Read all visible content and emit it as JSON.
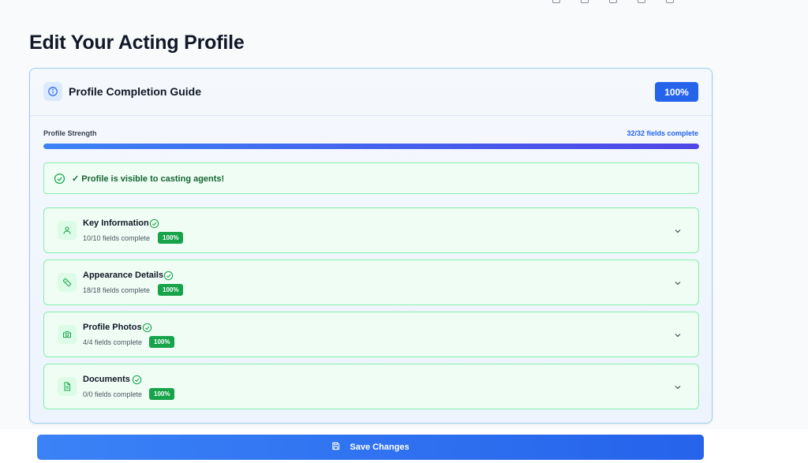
{
  "page": {
    "title": "Edit Your Acting Profile"
  },
  "guide": {
    "title": "Profile Completion Guide",
    "completion_badge": "100%",
    "strength_label": "Profile Strength",
    "strength_count": "32/32 fields complete",
    "strength_fraction": 1.0,
    "visible_message": "✓ Profile is visible to casting agents!"
  },
  "sections": [
    {
      "title": "Key Information",
      "count": "10/10 fields complete",
      "badge": "100%",
      "icon": "user-icon"
    },
    {
      "title": "Appearance Details",
      "count": "18/18 fields complete",
      "badge": "100%",
      "icon": "ruler-icon"
    },
    {
      "title": "Profile Photos",
      "count": "4/4 fields complete",
      "badge": "100%",
      "icon": "camera-icon"
    },
    {
      "title": "Documents",
      "count": "0/0 fields complete",
      "badge": "100%",
      "icon": "document-icon"
    }
  ],
  "footer": {
    "save_label": "Save Changes"
  },
  "colors": {
    "accent": "#2563eb",
    "success": "#16a34a",
    "success_bg": "#f0fdf4",
    "success_border": "#86efac"
  }
}
